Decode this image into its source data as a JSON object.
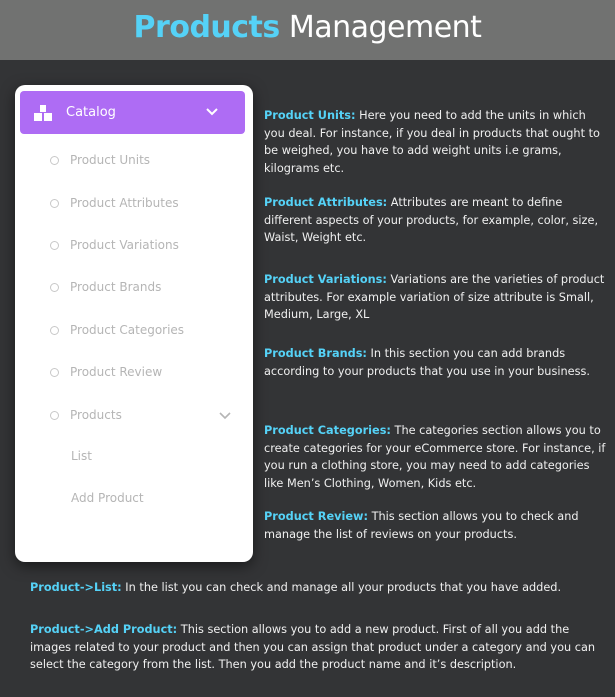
{
  "header": {
    "title_highlight": "Products",
    "title_rest": "Management"
  },
  "sidebar": {
    "catalog_label": "Catalog",
    "items": [
      {
        "label": "Product Units"
      },
      {
        "label": "Product Attributes"
      },
      {
        "label": "Product Variations"
      },
      {
        "label": "Product Brands"
      },
      {
        "label": "Product Categories"
      },
      {
        "label": "Product Review"
      },
      {
        "label": "Products"
      }
    ],
    "sub_items": [
      {
        "label": "List"
      },
      {
        "label": "Add Product"
      }
    ]
  },
  "descriptions": [
    {
      "label": "Product Units:",
      "text": " Here you need to add the units in which you deal. For instance, if you deal in products that ought to be weighed, you have to add weight units i.e grams, kilograms etc."
    },
    {
      "label": "Product Attributes:",
      "text": " Attributes are meant to define different aspects of your products, for example, color, size, Waist, Weight etc."
    },
    {
      "label": "Product Variations:",
      "text": " Variations are the varieties of product attributes. For example variation of size attribute is Small, Medium, Large, XL"
    },
    {
      "label": "Product Brands:",
      "text": " In this section you can add brands according to your products that you use in your business."
    },
    {
      "label": "Product Categories:",
      "text": " The categories section allows you to create categories for your eCommerce store. For instance, if you run a clothing store, you may need to add categories like Men’s Clothing, Women, Kids etc."
    },
    {
      "label": "Product Review:",
      "text": " This section allows you to check and manage the list of reviews on your products."
    }
  ],
  "bottom": [
    {
      "label": "Product->List:",
      "text": " In the list you can check and manage all your products that you have added."
    },
    {
      "label": "Product->Add Product:",
      "text": " This section allows you to add a new product. First of all you add the images related to your product and then you can assign that product under a category and you can select the category from the list. Then you add the product name and it’s description."
    }
  ],
  "colors": {
    "accent": "#55d2f7",
    "catalog_bg": "#ae6cf4",
    "page_bg": "#333436",
    "header_bg": "#717271"
  }
}
